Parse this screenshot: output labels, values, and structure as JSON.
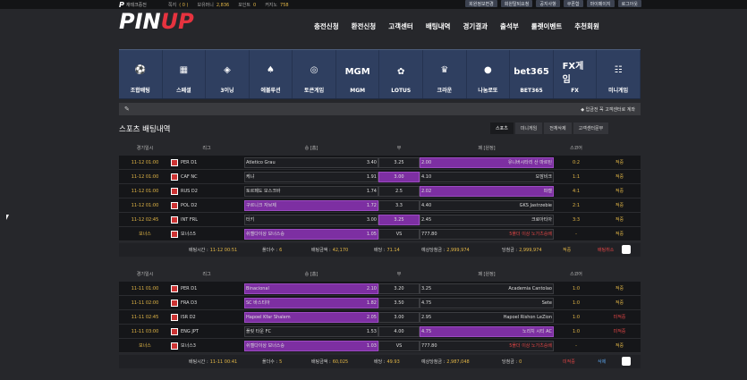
{
  "topbar": {
    "logo_mark": "P",
    "site_label": "재테크중전",
    "stats": [
      {
        "label": "쪽지",
        "value": "( 0 )"
      },
      {
        "label": "보유머니",
        "value": "2,836"
      },
      {
        "label": "포인트",
        "value": "0"
      },
      {
        "label": "커지노",
        "value": "758"
      }
    ],
    "buttons": [
      "회원정보변경",
      "회원탈퇴요청",
      "공지사항",
      "쿠폰함",
      "마이페이지",
      "로그아웃"
    ]
  },
  "logo": {
    "word_a": "PIN",
    "word_b": "UP"
  },
  "mainnav": [
    "충전신청",
    "환전신청",
    "고객센터",
    "배팅내역",
    "경기결과",
    "출석부",
    "룰렛이벤트",
    "추천회원"
  ],
  "games": [
    {
      "label": "조합배팅",
      "icon": "soccer-ball-icon",
      "glyph": "⚽"
    },
    {
      "label": "스페셜",
      "icon": "calendar-ball-icon",
      "glyph": "▦"
    },
    {
      "label": "3이닝",
      "icon": "baseball-field-icon",
      "glyph": "◈"
    },
    {
      "label": "에볼루션",
      "icon": "evolution-cards-icon",
      "glyph": "♠"
    },
    {
      "label": "토큰게임",
      "icon": "token-ring-icon",
      "glyph": "◎"
    },
    {
      "label": "MGM",
      "icon": "mgm-logo-icon",
      "glyph": "MGM"
    },
    {
      "label": "LOTUS",
      "icon": "lotus-logo-icon",
      "glyph": "✿"
    },
    {
      "label": "크라운",
      "icon": "crown-icon",
      "glyph": "♛"
    },
    {
      "label": "나눔로또",
      "icon": "lotto-ball-icon",
      "glyph": "●"
    },
    {
      "label": "BET365",
      "icon": "bet365-logo-icon",
      "glyph": "bet365"
    },
    {
      "label": "FX",
      "icon": "fx-game-icon",
      "glyph": "FX게임"
    },
    {
      "label": "미니게임",
      "icon": "ladder-icon",
      "glyph": "☷"
    }
  ],
  "notice": {
    "text": "◆ 입금전 꼭 고객센터로 계좌"
  },
  "page_title": "스포츠 배팅내역",
  "tabs": [
    "스포츠",
    "미니게임",
    "전체삭제",
    "고객센터문부"
  ],
  "columns": [
    "경기일시",
    "리그",
    "승 [홈]",
    "무",
    "패 [원정]",
    "스코어"
  ],
  "slips": [
    {
      "rows": [
        {
          "date": "11-12 01:00",
          "league": "PER D1",
          "home": "Atletico Grau",
          "home_odds": "3.40",
          "draw": "3.25",
          "away": "유니버시타리 산 마르틴",
          "away_odds": "2.00",
          "score": "0:2",
          "result": "적중",
          "pick": "away"
        },
        {
          "date": "11-12 01:00",
          "league": "CAF NC",
          "home": "케냐",
          "home_odds": "1.91",
          "draw": "3.00",
          "away": "모잠비크",
          "away_odds": "4.10",
          "score": "1:1",
          "result": "적중",
          "pick": "draw"
        },
        {
          "date": "11-12 01:00",
          "league": "RUS D2",
          "home": "토르페도 모스크바",
          "home_odds": "1.74",
          "draw": "2.5",
          "away": "파켈",
          "away_odds": "2.02",
          "score": "4:1",
          "result": "적중",
          "pick": "away"
        },
        {
          "date": "11-12 01:00",
          "league": "POL D2",
          "home": "구르니크 자브제",
          "home_odds": "1.72",
          "draw": "3.3",
          "away": "GKS Jastrzebie",
          "away_odds": "4.40",
          "score": "2:1",
          "result": "적중",
          "pick": "home"
        },
        {
          "date": "11-12 02:45",
          "league": "INT FRL",
          "home": "터키",
          "home_odds": "3.00",
          "draw": "3.25",
          "away": "크로아티아",
          "away_odds": "2.45",
          "score": "3:3",
          "result": "적중",
          "pick": "draw"
        },
        {
          "date": "보너스",
          "league": "보너스5",
          "home": "쉬켈다이상 보너스승",
          "home_odds": "1.05",
          "draw": "VS",
          "away": "5폴더 이상 노가츠승배",
          "away_odds": "777.80",
          "score": "-",
          "result": "적중",
          "pick": "home"
        }
      ],
      "summary": {
        "bet_time_label": "배팅시간 :",
        "bet_time": "11-12 00:51",
        "folders_label": "폴더수 :",
        "folders": "6",
        "amount_label": "배팅금액 :",
        "amount": "42,170",
        "odds_label": "배당 :",
        "odds": "71.14",
        "expect_label": "예상당첨금 :",
        "expect": "2,999,974",
        "win_label": "당첨금 :",
        "win": "2,999,974",
        "status": "적중",
        "cancel": "배팅취소"
      }
    },
    {
      "rows": [
        {
          "date": "11-11 01:00",
          "league": "PER D1",
          "home": "Binacional",
          "home_odds": "2.10",
          "draw": "3.20",
          "away": "Academia Cantolao",
          "away_odds": "3.25",
          "score": "1:0",
          "result": "적중",
          "pick": "home"
        },
        {
          "date": "11-11 02:00",
          "league": "FRA D3",
          "home": "SC 바스티아",
          "home_odds": "1.82",
          "draw": "3.50",
          "away": "Sete",
          "away_odds": "4.75",
          "score": "1:0",
          "result": "적중",
          "pick": "home"
        },
        {
          "date": "11-11 02:45",
          "league": "ISR D2",
          "home": "Hapoel Kfar Shalem",
          "home_odds": "2.05",
          "draw": "3.00",
          "away": "Hapoel Rishon LeZion",
          "away_odds": "2.95",
          "score": "1:0",
          "result": "미적중",
          "pick": "home"
        },
        {
          "date": "11-11 03:00",
          "league": "ENG JPT",
          "home": "플릿 타운 FC",
          "home_odds": "1.53",
          "draw": "4.00",
          "away": "노리치 시티 AC",
          "away_odds": "4.75",
          "score": "1:0",
          "result": "미적중",
          "pick": "away"
        },
        {
          "date": "보너스",
          "league": "보너스3",
          "home": "쉬켈다이상 보너스승",
          "home_odds": "1.03",
          "draw": "VS",
          "away": "5폴더 이상 노가츠승배",
          "away_odds": "777.80",
          "score": "-",
          "result": "적중",
          "pick": "home"
        }
      ],
      "summary": {
        "bet_time_label": "배팅시간 :",
        "bet_time": "11-11 00:41",
        "folders_label": "폴더수 :",
        "folders": "5",
        "amount_label": "배팅금액 :",
        "amount": "60,025",
        "odds_label": "배당 :",
        "odds": "49.93",
        "expect_label": "예상당첨금 :",
        "expect": "2,987,048",
        "win_label": "당첨금 :",
        "win": "0",
        "status": "미적중",
        "cancel": "삭제"
      }
    }
  ],
  "colors": {
    "accent": "#e6333f",
    "selected": "#7d2fa2",
    "gold": "#e2b646",
    "win": "#e24545"
  }
}
